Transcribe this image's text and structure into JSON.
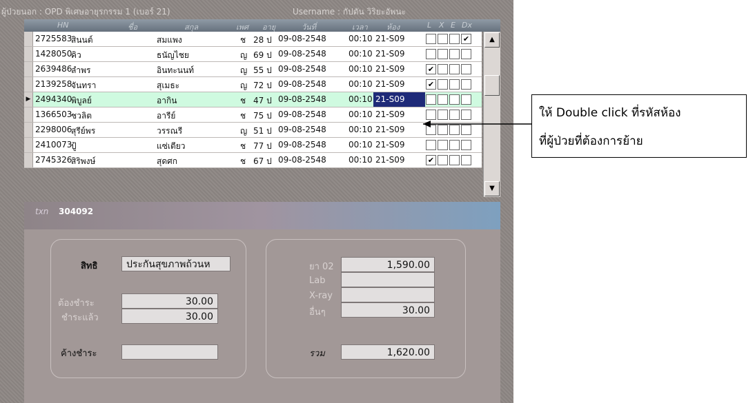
{
  "titlebar": {
    "section": "ผู้ป่วยนอก : OPD พิเศษอายุรกรรม 1 (เบอร์ 21)",
    "username": "Username : กัปตัน วิริยะอัพนะ"
  },
  "table": {
    "columns": [
      "HN",
      "ชื่อ",
      "สกุล",
      "เพศ",
      "อายุ",
      "วันที่",
      "เวลา",
      "ห้อง",
      "L",
      "X",
      "E",
      "Dx"
    ],
    "rows": [
      {
        "hn": "2725583",
        "first": "สินนต์",
        "last": "สมแพง",
        "sex": "ช",
        "age": "28 ป",
        "date": "09-08-2548",
        "time": "00:10",
        "room": "21-S09",
        "L": "",
        "X": "",
        "E": "",
        "Dx": "✔"
      },
      {
        "hn": "1428050",
        "first": "คิว",
        "last": "ธนัญไชย",
        "sex": "ญ",
        "age": "69 ป",
        "date": "09-08-2548",
        "time": "00:10",
        "room": "21-S09",
        "L": "",
        "X": "",
        "E": "",
        "Dx": ""
      },
      {
        "hn": "2639486",
        "first": "ลำพร",
        "last": "อินทะนนท์",
        "sex": "ญ",
        "age": "55 ป",
        "date": "09-08-2548",
        "time": "00:10",
        "room": "21-S09",
        "L": "✔",
        "X": "",
        "E": "",
        "Dx": ""
      },
      {
        "hn": "2139258",
        "first": "จันทรา",
        "last": "สุเมธะ",
        "sex": "ญ",
        "age": "72 ป",
        "date": "09-08-2548",
        "time": "00:10",
        "room": "21-S09",
        "L": "✔",
        "X": "",
        "E": "",
        "Dx": ""
      },
      {
        "hn": "2494340",
        "first": "พิบูลย์",
        "last": "อากิน",
        "sex": "ช",
        "age": "47 ป",
        "date": "09-08-2548",
        "time": "00:10",
        "room": "21-S09",
        "L": "",
        "X": "",
        "E": "",
        "Dx": ""
      },
      {
        "hn": "1366503",
        "first": "ชวลิต",
        "last": "อารีย์",
        "sex": "ช",
        "age": "75 ป",
        "date": "09-08-2548",
        "time": "00:10",
        "room": "21-S09",
        "L": "",
        "X": "",
        "E": "",
        "Dx": ""
      },
      {
        "hn": "2298006",
        "first": "สุรีย์พร",
        "last": "วรรณรี",
        "sex": "ญ",
        "age": "51 ป",
        "date": "09-08-2548",
        "time": "00:10",
        "room": "21-S09",
        "L": "",
        "X": "",
        "E": "",
        "Dx": ""
      },
      {
        "hn": "2410073",
        "first": "ปู้",
        "last": "แซ่เตียว",
        "sex": "ช",
        "age": "77 ป",
        "date": "09-08-2548",
        "time": "00:10",
        "room": "21-S09",
        "L": "",
        "X": "",
        "E": "",
        "Dx": ""
      },
      {
        "hn": "2745326",
        "first": "สิริพงษ์",
        "last": "สุดศก",
        "sex": "ช",
        "age": "67 ป",
        "date": "09-08-2548",
        "time": "00:10",
        "room": "21-S09",
        "L": "✔",
        "X": "",
        "E": "",
        "Dx": ""
      }
    ],
    "row_pointer": "▶"
  },
  "txn": {
    "label": "txn",
    "value": "304092"
  },
  "left_box": {
    "right_label": "สิทธิ",
    "right_value": "ประกันสุขภาพถ้วนห",
    "due_label": "ต้องชำระ",
    "due_value": "30.00",
    "paid_label": "ชำระแล้ว",
    "paid_value": "30.00",
    "owed_label": "ค้างชำระ",
    "owed_value": ""
  },
  "right_box": {
    "drug_label": "ยา 02",
    "drug_value": "1,590.00",
    "lab_label": "Lab",
    "lab_value": "",
    "xray_label": "X-ray",
    "xray_value": "",
    "other_label": "อื่นๆ",
    "other_value": "30.00",
    "total_label": "รวม",
    "total_value": "1,620.00"
  },
  "callout": {
    "line1": "ให้ Double click ที่รหัสห้อง",
    "line2": "ที่ผู้ป่วยที่ต้องการย้าย"
  },
  "scrollbar": {
    "up_icon": "▲",
    "down_icon": "▼"
  }
}
